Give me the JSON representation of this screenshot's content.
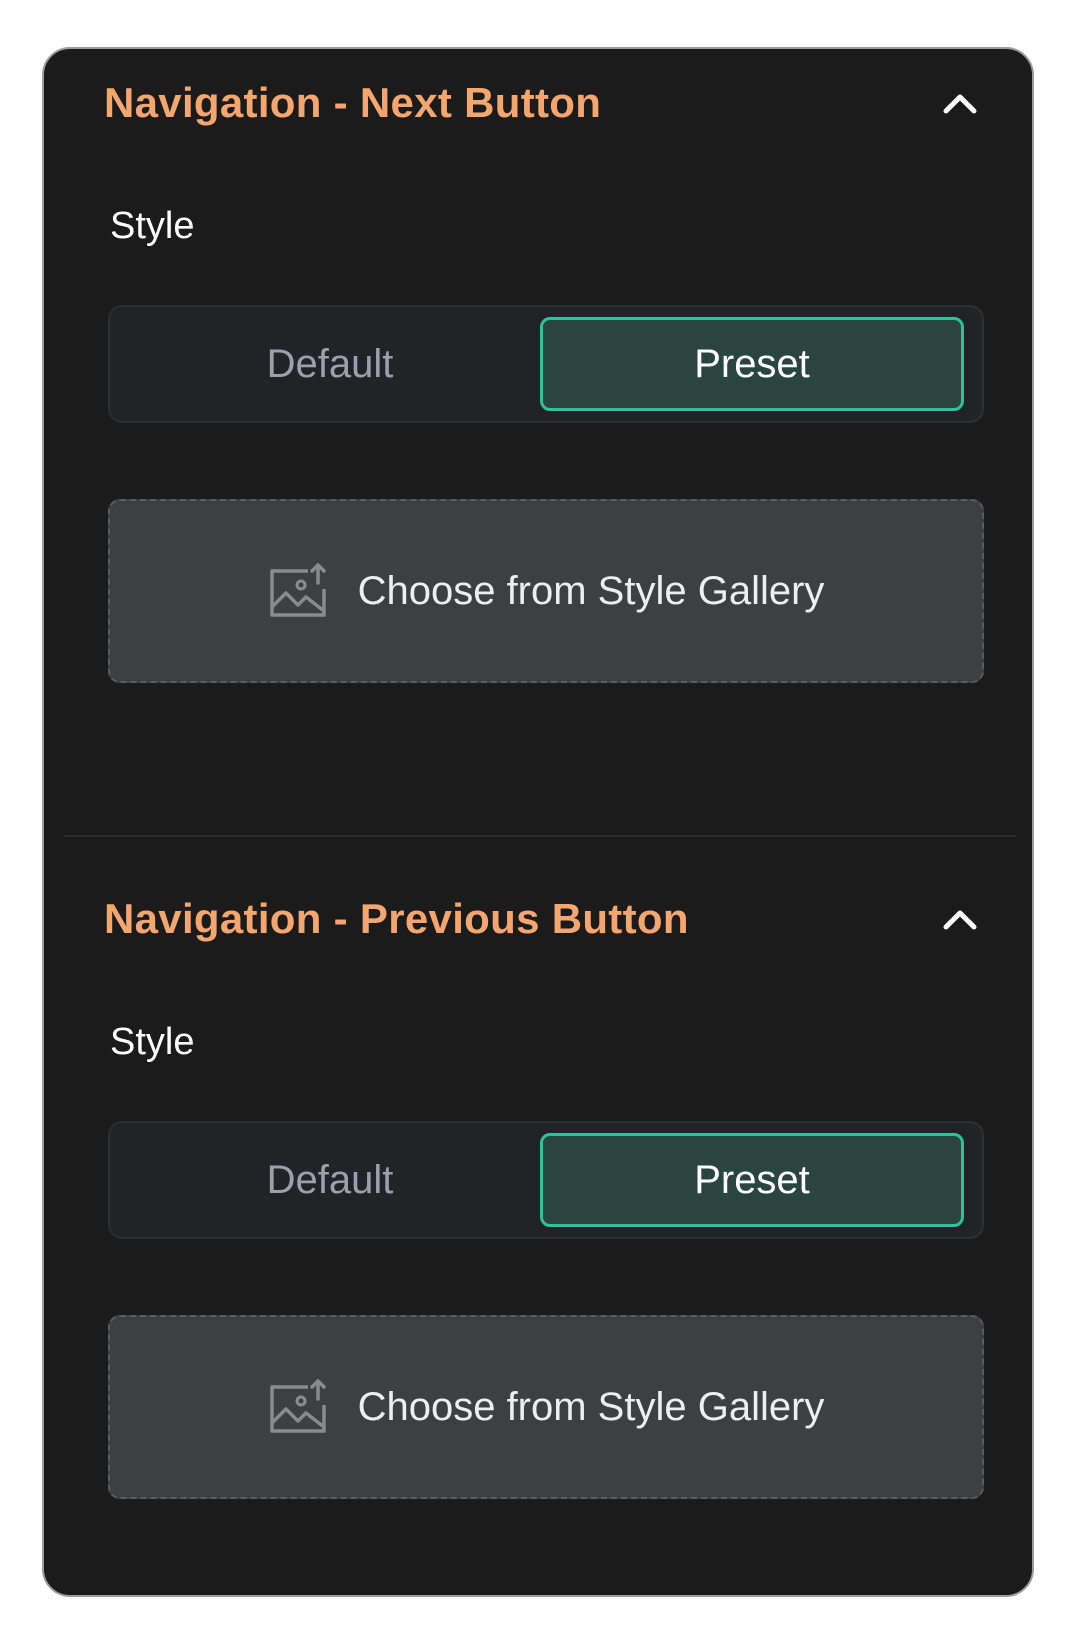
{
  "sections": [
    {
      "title": "Navigation - Next Button",
      "toggle_icon": "chevron-up-icon",
      "style_label": "Style",
      "options": [
        "Default",
        "Preset"
      ],
      "selected": "Preset",
      "gallery_label": "Choose from Style Gallery",
      "gallery_icon": "image-upload-icon"
    },
    {
      "title": "Navigation - Previous Button",
      "toggle_icon": "chevron-up-icon",
      "style_label": "Style",
      "options": [
        "Default",
        "Preset"
      ],
      "selected": "Preset",
      "gallery_label": "Choose from Style Gallery",
      "gallery_icon": "image-upload-icon"
    }
  ],
  "colors": {
    "panel_bg": "#1b1b1c",
    "title": "#f5a66f",
    "accent": "#2fc39c",
    "selected_bg": "#2a4540"
  }
}
